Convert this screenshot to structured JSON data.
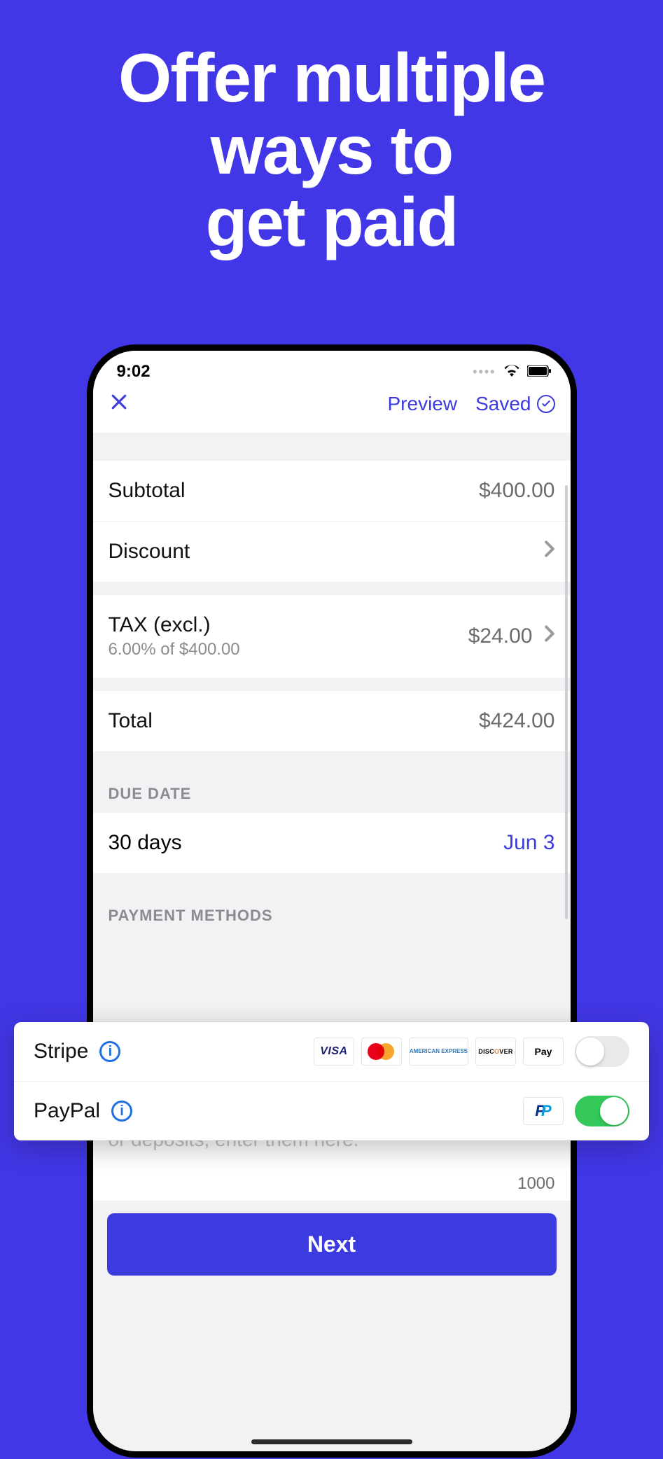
{
  "headline": {
    "line1": "Offer multiple",
    "line2": "ways to",
    "line3": "get paid"
  },
  "statusBar": {
    "time": "9:02"
  },
  "nav": {
    "preview": "Preview",
    "saved": "Saved"
  },
  "summary": {
    "subtotalLabel": "Subtotal",
    "subtotalValue": "$400.00",
    "discountLabel": "Discount",
    "taxLabel": "TAX (excl.)",
    "taxSub": "6.00% of $400.00",
    "taxValue": "$24.00",
    "totalLabel": "Total",
    "totalValue": "$424.00"
  },
  "dueDate": {
    "header": "DUE DATE",
    "term": "30 days",
    "date": "Jun 3"
  },
  "paymentMethods": {
    "header": "PAYMENT METHODS",
    "stripe": {
      "label": "Stripe",
      "enabled": false
    },
    "paypal": {
      "label": "PayPal",
      "enabled": true
    },
    "brands": {
      "visa": "VISA",
      "amex": "AMERICAN EXPRESS",
      "discover": "DISCOVER",
      "applePay": "Pay"
    }
  },
  "notes": {
    "placeholder": "If you have specific instructions around payments or deposits, enter them here.",
    "charCount": "1000"
  },
  "nextButton": "Next"
}
